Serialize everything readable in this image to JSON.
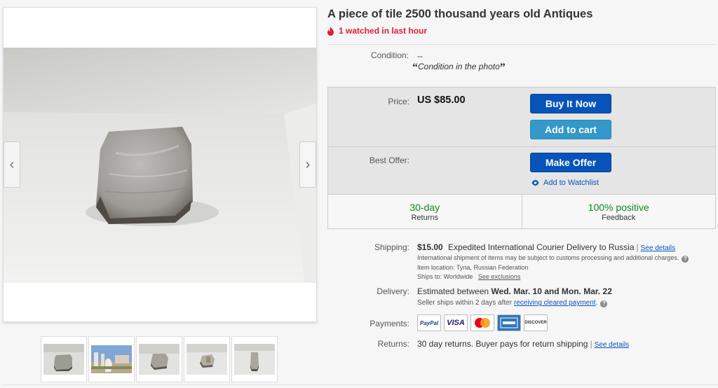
{
  "listing": {
    "title": "A piece of tile 2500 thousand years old Antiques",
    "watch_text": "1 watched in last hour"
  },
  "condition": {
    "label": "Condition:",
    "value": "--",
    "note": "Condition in the photo"
  },
  "buybox": {
    "price_label": "Price:",
    "price_value": "US $85.00",
    "buy_now": "Buy It Now",
    "add_to_cart": "Add to cart",
    "best_offer_label": "Best Offer:",
    "make_offer": "Make Offer",
    "add_to_watchlist": "Add to Watchlist",
    "badges": [
      {
        "top": "30-day",
        "bottom": "Returns"
      },
      {
        "top": "100% positive",
        "bottom": "Feedback"
      }
    ]
  },
  "shipping": {
    "label": "Shipping:",
    "price": "$15.00",
    "method": "Expedited International Courier Delivery to Russia",
    "see_details": "See details",
    "customs_note": "International shipment of items may be subject to customs processing and additional charges.",
    "item_location": "Item location:  Tyna, Russian Federation",
    "ships_to": "Ships to:  Worldwide",
    "see_exclusions": "See exclusions"
  },
  "delivery": {
    "label": "Delivery:",
    "prefix": "Estimated between",
    "dates": "Wed. Mar. 10 and Mon. Mar. 22",
    "ships_within": "Seller ships within 2 days after",
    "payment_link": "receiving cleared payment"
  },
  "payments": {
    "label": "Payments:",
    "methods": [
      "PayPal",
      "VISA",
      "MasterCard",
      "AMEX",
      "DISCOVER"
    ]
  },
  "returns": {
    "label": "Returns:",
    "text": "30 day returns. Buyer pays for return shipping",
    "see_details": "See details"
  },
  "colors": {
    "accent_blue": "#0654ba",
    "cart_blue": "#3498ca",
    "watch_red": "#dd1e31",
    "badge_green": "#0e8a1f"
  },
  "icons": {
    "fire": "fire-icon",
    "eye": "eye-icon",
    "help": "help-icon",
    "prev": "chevron-left-icon",
    "next": "chevron-right-icon"
  }
}
